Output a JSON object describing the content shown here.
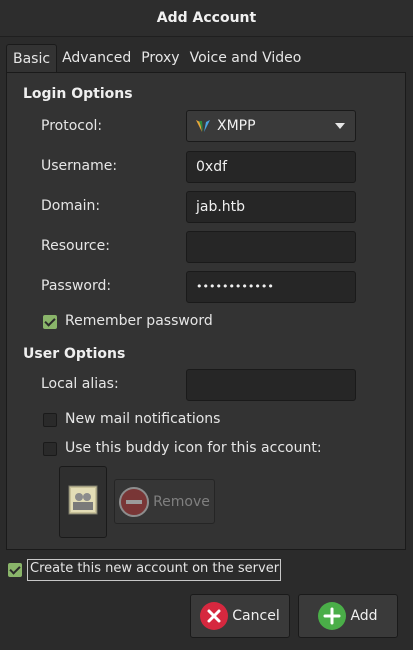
{
  "window": {
    "title": "Add Account"
  },
  "tabs": [
    {
      "label": "Basic",
      "active": true
    },
    {
      "label": "Advanced"
    },
    {
      "label": "Proxy"
    },
    {
      "label": "Voice and Video"
    }
  ],
  "login_options": {
    "title": "Login Options",
    "protocol": {
      "label": "Protocol:",
      "value": "XMPP",
      "icon": "xmpp-logo-icon"
    },
    "username": {
      "label": "Username:",
      "value": "0xdf"
    },
    "domain": {
      "label": "Domain:",
      "value": "jab.htb"
    },
    "resource": {
      "label": "Resource:",
      "value": ""
    },
    "password": {
      "label": "Password:",
      "value": "••••••••••••"
    },
    "remember_password": {
      "label": "Remember password",
      "checked": true
    }
  },
  "user_options": {
    "title": "User Options",
    "local_alias": {
      "label": "Local alias:",
      "value": ""
    },
    "new_mail": {
      "label": "New mail notifications",
      "checked": false
    },
    "buddy_icon": {
      "label": "Use this buddy icon for this account:",
      "checked": false
    },
    "remove_label": "Remove"
  },
  "create_account": {
    "label": "Create this new account on the server",
    "checked": true
  },
  "buttons": {
    "cancel": "Cancel",
    "add": "Add"
  },
  "colors": {
    "accent_green": "#8ab56a",
    "cancel_red": "#d6283f",
    "add_green": "#4aae48"
  }
}
